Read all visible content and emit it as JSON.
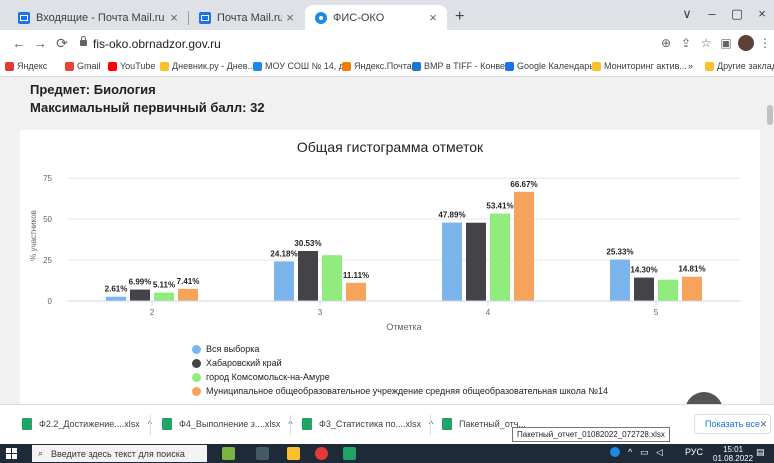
{
  "browser": {
    "tabs": [
      {
        "title": "Входящие - Почта Mail.ru",
        "close": "×",
        "favicon": "mail-icon"
      },
      {
        "title": "Почта Mail.ru",
        "close": "×",
        "favicon": "mail-icon"
      },
      {
        "title": "ФИС-ОКО",
        "close": "×",
        "favicon": "fis-oko-icon"
      }
    ],
    "new_tab": "+",
    "window_controls": [
      "∨",
      "–",
      "▢",
      "×"
    ],
    "url": "fis-oko.obrnadzor.gov.ru",
    "nav": {
      "back": "←",
      "forward": "→",
      "reload": "⟳"
    },
    "toolbar_icons": [
      "⊕",
      "⇪",
      "☆",
      "▣"
    ],
    "menu": "⋮",
    "bookmarks": [
      {
        "label": "Яндекс",
        "color": "#e53935"
      },
      {
        "label": "Gmail",
        "color": "#ea4335"
      },
      {
        "label": "YouTube",
        "color": "#ff0000"
      },
      {
        "label": "Дневник.ру - Днев...",
        "color": "#fbc02d"
      },
      {
        "label": "МОУ СОШ № 14, д...",
        "color": "#1e88e5"
      },
      {
        "label": "Яндекс.Почта",
        "color": "#f57c00"
      },
      {
        "label": "BMP в TIFF - Конве...",
        "color": "#1976d2"
      },
      {
        "label": "Google Календарь",
        "color": "#1a73e8"
      },
      {
        "label": "Мониторинг актив...",
        "color": "#fbc02d"
      }
    ],
    "bookmarks_more": "»",
    "other_bookmarks": "Другие закладки"
  },
  "page": {
    "subject": "Предмет: Биология",
    "max_score": "Максимальный первичный балл: 32",
    "scroll_top_icon": "»"
  },
  "chart_data": {
    "type": "bar",
    "title": "Общая гистограмма отметок",
    "xlabel": "Отметка",
    "ylabel": "% участников",
    "categories": [
      "2",
      "3",
      "4",
      "5"
    ],
    "ylim": [
      0,
      80
    ],
    "yticks": [
      0,
      25,
      50,
      75
    ],
    "grid": true,
    "legend_position": "bottom-left",
    "series": [
      {
        "name": "Вся выборка",
        "color": "#7cb5ec",
        "values": [
          2.61,
          24.18,
          47.89,
          25.33
        ],
        "labels": [
          "2.61%",
          "24.18%",
          "47.89%",
          "25.33%"
        ]
      },
      {
        "name": "Хабаровский край",
        "color": "#434348",
        "values": [
          6.99,
          30.53,
          47.8,
          14.3
        ],
        "labels": [
          "6.99%",
          "30.53%",
          "",
          "14.30%"
        ]
      },
      {
        "name": "город Комсомольск-на-Амуре",
        "color": "#90ed7d",
        "values": [
          5.11,
          28.0,
          53.41,
          13.0
        ],
        "labels": [
          "5.11%",
          "",
          "53.41%",
          ""
        ]
      },
      {
        "name": "Муниципальное общеобразовательное учреждение средняя общеобразовательная школа №14",
        "color": "#f7a35c",
        "values": [
          7.41,
          11.11,
          66.67,
          14.81
        ],
        "labels": [
          "7.41%",
          "11.11%",
          "66.67%",
          "14.81%"
        ]
      }
    ]
  },
  "downloads": {
    "items": [
      {
        "name": "Ф2.2_Достижение....xlsx"
      },
      {
        "name": "Ф4_Выполнение з....xlsx"
      },
      {
        "name": "Ф3_Статистика по....xlsx"
      },
      {
        "name": "Пакетный_отч..."
      }
    ],
    "chevron": "^",
    "show_all": "Показать все",
    "close": "×",
    "tooltip": "Пакетный_отчет_01082022_072728.xlsx"
  },
  "taskbar": {
    "search_placeholder": "Введите здесь текст для поиска",
    "tray_lang": "РУС",
    "time": "15:01",
    "date": "01.08.2022"
  }
}
